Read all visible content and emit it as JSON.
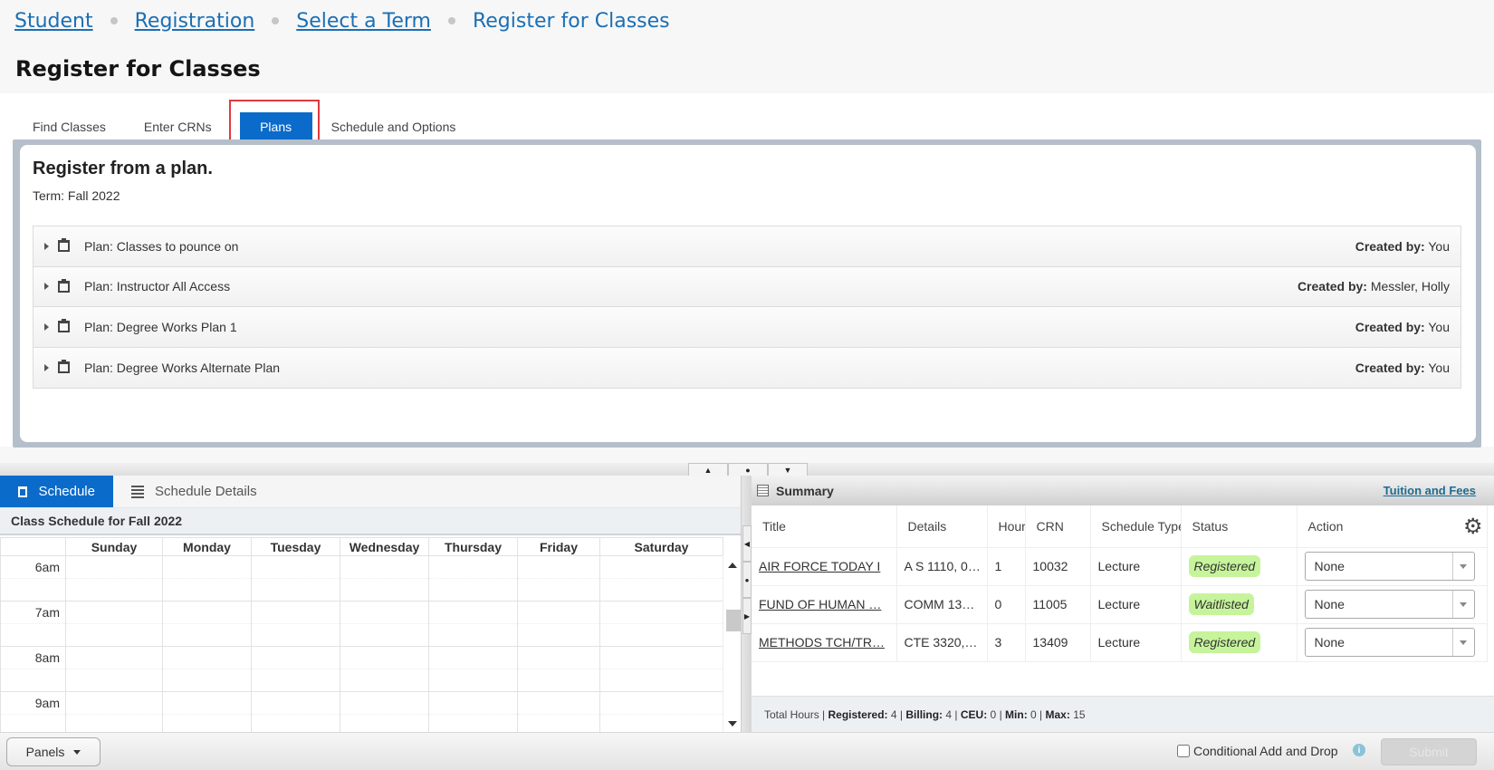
{
  "breadcrumb": {
    "items": [
      "Student",
      "Registration",
      "Select a Term"
    ],
    "current": "Register for Classes"
  },
  "page_title": "Register for Classes",
  "tabs": [
    {
      "label": "Find Classes",
      "active": false
    },
    {
      "label": "Enter CRNs",
      "active": false
    },
    {
      "label": "Plans",
      "active": true
    },
    {
      "label": "Schedule and Options",
      "active": false
    }
  ],
  "plans_panel": {
    "heading": "Register from a plan.",
    "term": "Term: Fall 2022",
    "created_by_label": "Created by:",
    "plans": [
      {
        "name": "Plan: Classes to pounce on",
        "created_by": "You"
      },
      {
        "name": "Plan: Instructor All Access",
        "created_by": "Messler, Holly"
      },
      {
        "name": "Plan: Degree Works Plan 1",
        "created_by": "You"
      },
      {
        "name": "Plan: Degree Works Alternate Plan",
        "created_by": "You"
      }
    ]
  },
  "schedule_panel": {
    "tabs": [
      {
        "label": "Schedule",
        "active": true
      },
      {
        "label": "Schedule Details",
        "active": false
      }
    ],
    "title": "Class Schedule for Fall 2022",
    "days": [
      "Sunday",
      "Monday",
      "Tuesday",
      "Wednesday",
      "Thursday",
      "Friday",
      "Saturday"
    ],
    "times": [
      "6am",
      "7am",
      "8am",
      "9am"
    ]
  },
  "summary_panel": {
    "title": "Summary",
    "tuition_link": "Tuition and Fees",
    "columns": [
      "Title",
      "Details",
      "Hours",
      "CRN",
      "Schedule Type",
      "Status",
      "Action"
    ],
    "rows": [
      {
        "title": "AIR FORCE TODAY I",
        "details": "A S 1110, 0…",
        "hours": "1",
        "crn": "10032",
        "schedule_type": "Lecture",
        "status": "Registered",
        "action": "None"
      },
      {
        "title": "FUND OF HUMAN …",
        "details": "COMM 13…",
        "hours": "0",
        "crn": "11005",
        "schedule_type": "Lecture",
        "status": "Waitlisted",
        "action": "None"
      },
      {
        "title": "METHODS TCH/TR…",
        "details": "CTE 3320,…",
        "hours": "3",
        "crn": "13409",
        "schedule_type": "Lecture",
        "status": "Registered",
        "action": "None"
      }
    ],
    "totals": {
      "label": "Total Hours",
      "registered_label": "Registered:",
      "registered": "4",
      "billing_label": "Billing:",
      "billing": "4",
      "ceu_label": "CEU:",
      "ceu": "0",
      "min_label": "Min:",
      "min": "0",
      "max_label": "Max:",
      "max": "15"
    }
  },
  "footer": {
    "panels_label": "Panels",
    "conditional_label": "Conditional Add and Drop",
    "conditional_checked": false,
    "submit_label": "Submit"
  },
  "colors": {
    "accent": "#0b6bca",
    "link": "#1a6fb5",
    "status_badge": "#c6f49b",
    "highlight_box": "#e0393e"
  }
}
